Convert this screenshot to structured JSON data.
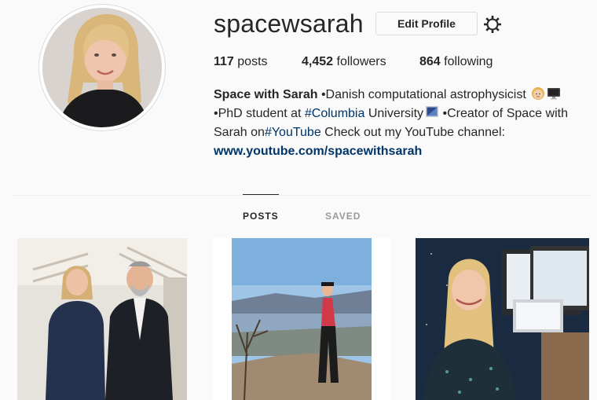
{
  "profile": {
    "username": "spacewsarah",
    "edit_label": "Edit Profile",
    "stats": {
      "posts_count": "117",
      "posts_label": "posts",
      "followers_count": "4,452",
      "followers_label": "followers",
      "following_count": "864",
      "following_label": "following"
    },
    "bio": {
      "name": "Space with Sarah",
      "line1_text": " •Danish computational astrophysicist ",
      "line2_prefix": "•PhD student at ",
      "tag_columbia": "#Columbia",
      "line2_mid": " University",
      "line2_suffix": " •Creator of Space with Sarah on",
      "tag_youtube": "#YouTube",
      "line3_text": " Check out my YouTube channel:",
      "link": "www.youtube.com/spacewithsarah"
    }
  },
  "tabs": {
    "posts": "POSTS",
    "saved": "SAVED"
  },
  "colors": {
    "link": "#003569",
    "text": "#262626",
    "muted": "#999999",
    "border": "#dbdbdb",
    "background": "#fafafa"
  },
  "icons": {
    "settings": "gear-icon",
    "emoji_woman": "woman-emoji-icon",
    "emoji_computer": "desktop-computer-icon",
    "emoji_macbook": "laptop-emoji-icon"
  }
}
